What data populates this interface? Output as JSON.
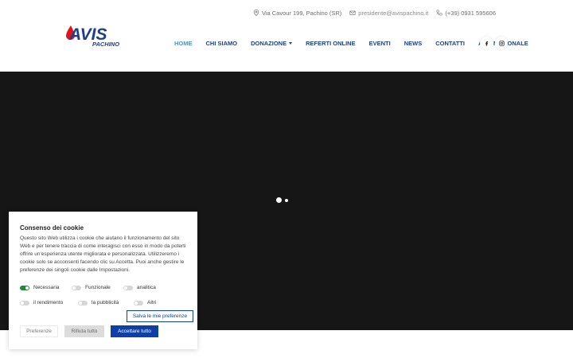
{
  "contact": {
    "address": "Via Cavour 199, Pachino (SR)",
    "email": "presidente@avispachino.it",
    "phone": "(+39) 0931 595606"
  },
  "logo": {
    "main": "AVIS",
    "sub": "PACHINO",
    "color": "#1d3f8a",
    "accent": "#e3131b"
  },
  "nav": {
    "items": [
      {
        "label": "HOME",
        "active": true
      },
      {
        "label": "CHI SIAMO"
      },
      {
        "label": "DONAZIONE",
        "dropdown": true
      },
      {
        "label": "REFERTI ONLINE"
      },
      {
        "label": "EVENTI"
      },
      {
        "label": "NEWS"
      },
      {
        "label": "CONTATTI"
      },
      {
        "label": "AVIS NAZIONALE"
      }
    ],
    "social": [
      "facebook-icon",
      "instagram-icon"
    ]
  },
  "hero": {
    "background": "#161616"
  },
  "cookie": {
    "title": "Consenso dei cookie",
    "text": "Questo sito Web utilizza i cookie che aiutano il funzionamento del sito Web e per tenere traccia di come interagisci con esso in modo da poterti offrire un'esperienza utente migliorata e personalizzata. Utilizzeremo i cookie solo se acconsenti facendo clic su Accetta. Puoi anche gestire le preferenze dei singoli cookie dalle Impostazioni.",
    "toggles": {
      "necessaria": "Necessaria",
      "funzionale": "Funzionale",
      "analitica": "analitica",
      "rendimento": "il rendimento",
      "pubblicita": "la pubblicità",
      "altri": "Altri"
    },
    "save_label": "Salva le mie preferenze",
    "preferences_label": "Preferenze",
    "reject_label": "Rifiuta tutto",
    "accept_label": "Accettare tutto",
    "accent": "#0d3fa6"
  }
}
